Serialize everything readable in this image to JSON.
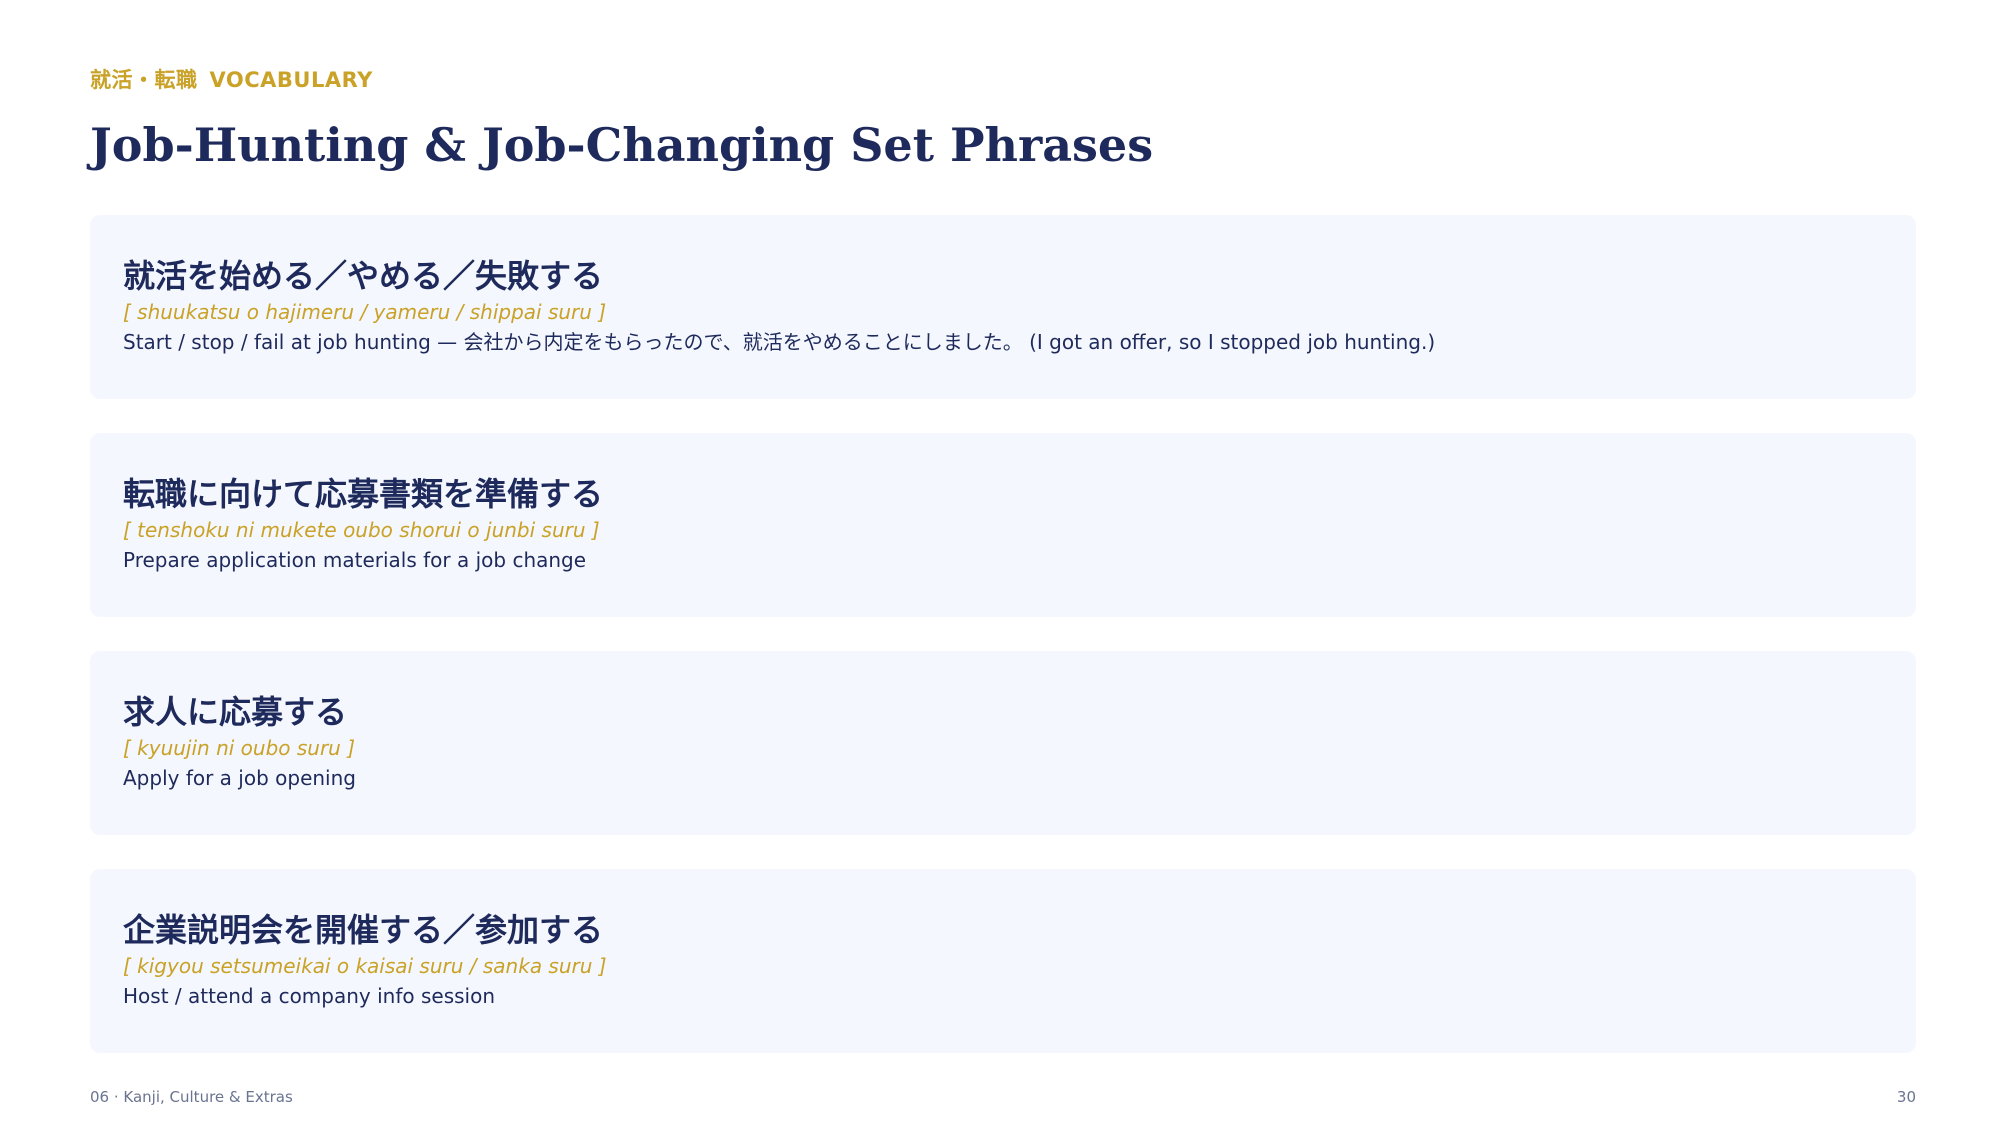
{
  "header": {
    "eyebrow_jp": "就活・転職",
    "eyebrow_en": "VOCABULARY",
    "title": "Job-Hunting & Job-Changing Set Phrases"
  },
  "phrases": [
    {
      "japanese": "就活を始める／やめる／失敗する",
      "romaji": "[ shuukatsu o hajimeru / yameru / shippai suru ]",
      "meaning": "Start / stop / fail at job hunting —  会社から内定をもらったので、就活をやめることにしました。 (I got an offer, so I stopped job hunting.)"
    },
    {
      "japanese": "転職に向けて応募書類を準備する",
      "romaji": "[ tenshoku ni mukete oubo shorui o junbi suru ]",
      "meaning": "Prepare application materials for a job change"
    },
    {
      "japanese": "求人に応募する",
      "romaji": "[ kyuujin ni oubo suru ]",
      "meaning": "Apply for a job opening"
    },
    {
      "japanese": "企業説明会を開催する／参加する",
      "romaji": "[ kigyou setsumeikai o kaisai suru / sanka suru ]",
      "meaning": "Host / attend a company info session"
    }
  ],
  "footer": {
    "section": "06 · Kanji, Culture & Extras",
    "page_number": "30"
  },
  "colors": {
    "navy": "#1f2a5c",
    "gold": "#c9a227",
    "card_background": "#f4f7fd"
  }
}
